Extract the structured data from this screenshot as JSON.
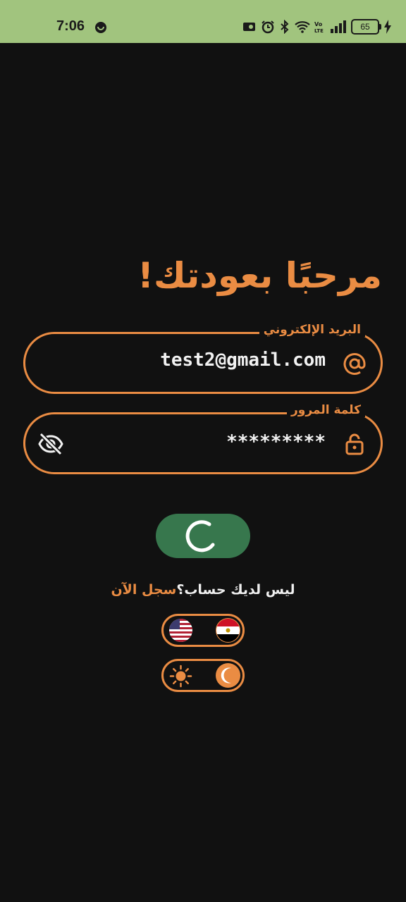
{
  "status_bar": {
    "time": "7:06",
    "battery_level": "65",
    "icons": [
      "media-icon",
      "alarm-icon",
      "bluetooth-icon",
      "wifi-icon",
      "volte-icon",
      "signal-icon",
      "battery-icon",
      "charging-icon"
    ]
  },
  "login": {
    "title": "مرحبًا بعودتك!",
    "email_label": "البريد الإلكتروني",
    "email_value": "test2@gmail.com",
    "password_label": "كلمة المرور",
    "password_value": "*********",
    "no_account_text": "ليس لديك حساب؟",
    "signup_link": "سجل الآن"
  },
  "toggles": {
    "language": {
      "options": [
        "us-flag-icon",
        "egypt-flag-icon"
      ],
      "selected": "egypt-flag-icon"
    },
    "theme": {
      "options": [
        "sun-icon",
        "moon-icon"
      ],
      "selected": "moon-icon"
    }
  },
  "colors": {
    "accent": "#ea8c43",
    "background": "#111111",
    "status_bar": "#a1c47e",
    "button": "#37774d"
  }
}
